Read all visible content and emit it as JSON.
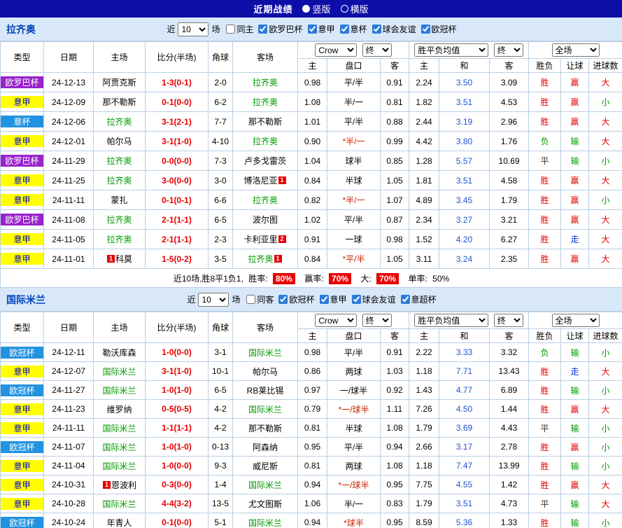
{
  "titlebar": {
    "title": "近期战绩",
    "options": [
      {
        "label": "竖版",
        "selected": true
      },
      {
        "label": "横版",
        "selected": false
      }
    ]
  },
  "columns": {
    "main": [
      "类型",
      "日期",
      "主场",
      "比分(半场)",
      "角球",
      "客场"
    ],
    "sub": [
      "主",
      "盘口",
      "客",
      "主",
      "和",
      "客",
      "胜负",
      "让球",
      "进球数"
    ]
  },
  "selects": {
    "bookmaker": "Crow",
    "final": "终",
    "avg": "胜平负均值",
    "scope": "全场"
  },
  "colors": {
    "title_bar_bg": "#0D0DA8",
    "section_bg": "#D9E8F8",
    "grid": "#B9CFE4",
    "win": "#E60000",
    "lose": "#009900",
    "draw": "#333333",
    "push": "#0033CC",
    "score": "#E60000",
    "team_highlight": "#009900",
    "draw_odds": "#2255CC",
    "handicap_star": "#CC2200",
    "type_europa_bg": "#9922CC",
    "type_seriea_bg": "#FFFF00",
    "type_seriea_fg": "#0000CC",
    "type_cup_bg": "#2193E0",
    "badge_bg": "#E60000",
    "team_name_fg": "#0044BB"
  },
  "sections": [
    {
      "team": "拉齐奥",
      "filter": {
        "prefix": "近",
        "count": "10",
        "suffix": "场",
        "same": {
          "label": "同主",
          "checked": false
        },
        "comps": [
          {
            "label": "欧罗巴杯",
            "checked": true
          },
          {
            "label": "意甲",
            "checked": true
          },
          {
            "label": "意杯",
            "checked": true
          },
          {
            "label": "球会友谊",
            "checked": true
          },
          {
            "label": "欧冠杯",
            "checked": true
          }
        ]
      },
      "rows": [
        {
          "type": "欧罗巴杯",
          "date": "24-12-13",
          "home": {
            "name": "阿贾克斯"
          },
          "score": "1-3(0-1)",
          "corner": "2-0",
          "away": {
            "name": "拉齐奥",
            "hl": true
          },
          "ah": [
            "0.98",
            "平/半",
            "0.91"
          ],
          "eu": [
            "2.24",
            "3.50",
            "3.09"
          ],
          "res": [
            "胜",
            "赢",
            "大"
          ]
        },
        {
          "type": "意甲",
          "date": "24-12-09",
          "home": {
            "name": "那不勒斯"
          },
          "score": "0-1(0-0)",
          "corner": "6-2",
          "away": {
            "name": "拉齐奥",
            "hl": true
          },
          "ah": [
            "1.08",
            "半/一",
            "0.81"
          ],
          "eu": [
            "1.82",
            "3.51",
            "4.53"
          ],
          "res": [
            "胜",
            "赢",
            "小"
          ]
        },
        {
          "type": "意杯",
          "date": "24-12-06",
          "home": {
            "name": "拉齐奥",
            "hl": true
          },
          "score": "3-1(2-1)",
          "corner": "7-7",
          "away": {
            "name": "那不勒斯"
          },
          "ah": [
            "1.01",
            "平/半",
            "0.88"
          ],
          "eu": [
            "2.44",
            "3.19",
            "2.96"
          ],
          "res": [
            "胜",
            "赢",
            "大"
          ]
        },
        {
          "type": "意甲",
          "date": "24-12-01",
          "home": {
            "name": "帕尔马"
          },
          "score": "3-1(1-0)",
          "corner": "4-10",
          "away": {
            "name": "拉齐奥",
            "hl": true
          },
          "ah": [
            "0.90",
            "*半/一",
            "0.99"
          ],
          "eu": [
            "4.42",
            "3.80",
            "1.76"
          ],
          "res": [
            "负",
            "输",
            "大"
          ]
        },
        {
          "type": "欧罗巴杯",
          "date": "24-11-29",
          "home": {
            "name": "拉齐奥",
            "hl": true
          },
          "score": "0-0(0-0)",
          "corner": "7-3",
          "away": {
            "name": "卢多戈雷茨"
          },
          "ah": [
            "1.04",
            "球半",
            "0.85"
          ],
          "eu": [
            "1.28",
            "5.57",
            "10.69"
          ],
          "res": [
            "平",
            "输",
            "小"
          ]
        },
        {
          "type": "意甲",
          "date": "24-11-25",
          "home": {
            "name": "拉齐奥",
            "hl": true
          },
          "score": "3-0(0-0)",
          "corner": "3-0",
          "away": {
            "name": "博洛尼亚",
            "card": "1",
            "card_side": "right"
          },
          "ah": [
            "0.84",
            "半球",
            "1.05"
          ],
          "eu": [
            "1.81",
            "3.51",
            "4.58"
          ],
          "res": [
            "胜",
            "赢",
            "大"
          ]
        },
        {
          "type": "意甲",
          "date": "24-11-11",
          "home": {
            "name": "蒙扎"
          },
          "score": "0-1(0-1)",
          "corner": "6-6",
          "away": {
            "name": "拉齐奥",
            "hl": true
          },
          "ah": [
            "0.82",
            "*半/一",
            "1.07"
          ],
          "eu": [
            "4.89",
            "3.45",
            "1.79"
          ],
          "res": [
            "胜",
            "赢",
            "小"
          ]
        },
        {
          "type": "欧罗巴杯",
          "date": "24-11-08",
          "home": {
            "name": "拉齐奥",
            "hl": true
          },
          "score": "2-1(1-1)",
          "corner": "6-5",
          "away": {
            "name": "波尔图"
          },
          "ah": [
            "1.02",
            "平/半",
            "0.87"
          ],
          "eu": [
            "2.34",
            "3.27",
            "3.21"
          ],
          "res": [
            "胜",
            "赢",
            "大"
          ]
        },
        {
          "type": "意甲",
          "date": "24-11-05",
          "home": {
            "name": "拉齐奥",
            "hl": true
          },
          "score": "2-1(1-1)",
          "corner": "2-3",
          "away": {
            "name": "卡利亚里",
            "card": "2",
            "card_side": "right"
          },
          "ah": [
            "0.91",
            "一球",
            "0.98"
          ],
          "eu": [
            "1.52",
            "4.20",
            "6.27"
          ],
          "res": [
            "胜",
            "走",
            "大"
          ]
        },
        {
          "type": "意甲",
          "date": "24-11-01",
          "home": {
            "name": "科莫",
            "card": "1",
            "card_side": "left"
          },
          "score": "1-5(0-2)",
          "corner": "3-5",
          "away": {
            "name": "拉齐奥",
            "hl": true,
            "card": "1",
            "card_side": "right"
          },
          "ah": [
            "0.84",
            "*平/半",
            "1.05"
          ],
          "eu": [
            "3.11",
            "3.24",
            "2.35"
          ],
          "res": [
            "胜",
            "赢",
            "大"
          ]
        }
      ],
      "summary": {
        "record": "近10场,胜8平1负1,",
        "win_label": "胜率:",
        "win_pct": "80%",
        "asia_label": "赢率:",
        "asia_pct": "70%",
        "big_label": "大:",
        "big_pct": "70%",
        "single_label": "单率:",
        "single_pct": "50%"
      }
    },
    {
      "team": "国际米兰",
      "filter": {
        "prefix": "近",
        "count": "10",
        "suffix": "场",
        "same": {
          "label": "同客",
          "checked": false
        },
        "comps": [
          {
            "label": "欧冠杯",
            "checked": true
          },
          {
            "label": "意甲",
            "checked": true
          },
          {
            "label": "球会友谊",
            "checked": true
          },
          {
            "label": "意超杯",
            "checked": true
          }
        ]
      },
      "rows": [
        {
          "type": "欧冠杯",
          "date": "24-12-11",
          "home": {
            "name": "勒沃库森"
          },
          "score": "1-0(0-0)",
          "corner": "3-1",
          "away": {
            "name": "国际米兰",
            "hl": true
          },
          "ah": [
            "0.98",
            "平/半",
            "0.91"
          ],
          "eu": [
            "2.22",
            "3.33",
            "3.32"
          ],
          "res": [
            "负",
            "输",
            "小"
          ]
        },
        {
          "type": "意甲",
          "date": "24-12-07",
          "home": {
            "name": "国际米兰",
            "hl": true
          },
          "score": "3-1(1-0)",
          "corner": "10-1",
          "away": {
            "name": "帕尔马"
          },
          "ah": [
            "0.86",
            "两球",
            "1.03"
          ],
          "eu": [
            "1.18",
            "7.71",
            "13.43"
          ],
          "res": [
            "胜",
            "走",
            "大"
          ]
        },
        {
          "type": "欧冠杯",
          "date": "24-11-27",
          "home": {
            "name": "国际米兰",
            "hl": true
          },
          "score": "1-0(1-0)",
          "corner": "6-5",
          "away": {
            "name": "RB莱比锡"
          },
          "ah": [
            "0.97",
            "一/球半",
            "0.92"
          ],
          "eu": [
            "1.43",
            "4.77",
            "6.89"
          ],
          "res": [
            "胜",
            "输",
            "小"
          ]
        },
        {
          "type": "意甲",
          "date": "24-11-23",
          "home": {
            "name": "维罗纳"
          },
          "score": "0-5(0-5)",
          "corner": "4-2",
          "away": {
            "name": "国际米兰",
            "hl": true
          },
          "ah": [
            "0.79",
            "*一/球半",
            "1.11"
          ],
          "eu": [
            "7.26",
            "4.50",
            "1.44"
          ],
          "res": [
            "胜",
            "赢",
            "大"
          ]
        },
        {
          "type": "意甲",
          "date": "24-11-11",
          "home": {
            "name": "国际米兰",
            "hl": true
          },
          "score": "1-1(1-1)",
          "corner": "4-2",
          "away": {
            "name": "那不勒斯"
          },
          "ah": [
            "0.81",
            "半球",
            "1.08"
          ],
          "eu": [
            "1.79",
            "3.69",
            "4.43"
          ],
          "res": [
            "平",
            "输",
            "小"
          ]
        },
        {
          "type": "欧冠杯",
          "date": "24-11-07",
          "home": {
            "name": "国际米兰",
            "hl": true
          },
          "score": "1-0(1-0)",
          "corner": "0-13",
          "away": {
            "name": "阿森纳"
          },
          "ah": [
            "0.95",
            "平/半",
            "0.94"
          ],
          "eu": [
            "2.66",
            "3.17",
            "2.78"
          ],
          "res": [
            "胜",
            "赢",
            "小"
          ]
        },
        {
          "type": "意甲",
          "date": "24-11-04",
          "home": {
            "name": "国际米兰",
            "hl": true
          },
          "score": "1-0(0-0)",
          "corner": "9-3",
          "away": {
            "name": "威尼斯"
          },
          "ah": [
            "0.81",
            "两球",
            "1.08"
          ],
          "eu": [
            "1.18",
            "7.47",
            "13.99"
          ],
          "res": [
            "胜",
            "输",
            "小"
          ]
        },
        {
          "type": "意甲",
          "date": "24-10-31",
          "home": {
            "name": "恩波利",
            "card": "1",
            "card_side": "left"
          },
          "score": "0-3(0-0)",
          "corner": "1-4",
          "away": {
            "name": "国际米兰",
            "hl": true
          },
          "ah": [
            "0.94",
            "*一/球半",
            "0.95"
          ],
          "eu": [
            "7.75",
            "4.55",
            "1.42"
          ],
          "res": [
            "胜",
            "赢",
            "大"
          ]
        },
        {
          "type": "意甲",
          "date": "24-10-28",
          "home": {
            "name": "国际米兰",
            "hl": true
          },
          "score": "4-4(3-2)",
          "corner": "13-5",
          "away": {
            "name": "尤文图斯"
          },
          "ah": [
            "1.06",
            "半/一",
            "0.83"
          ],
          "eu": [
            "1.79",
            "3.51",
            "4.73"
          ],
          "res": [
            "平",
            "输",
            "大"
          ]
        },
        {
          "type": "欧冠杯",
          "date": "24-10-24",
          "home": {
            "name": "年青人"
          },
          "score": "0-1(0-0)",
          "corner": "5-1",
          "away": {
            "name": "国际米兰",
            "hl": true
          },
          "ah": [
            "0.94",
            "*球半",
            "0.95"
          ],
          "eu": [
            "8.59",
            "5.36",
            "1.33"
          ],
          "res": [
            "胜",
            "输",
            "小"
          ]
        }
      ],
      "summary": null
    }
  ]
}
